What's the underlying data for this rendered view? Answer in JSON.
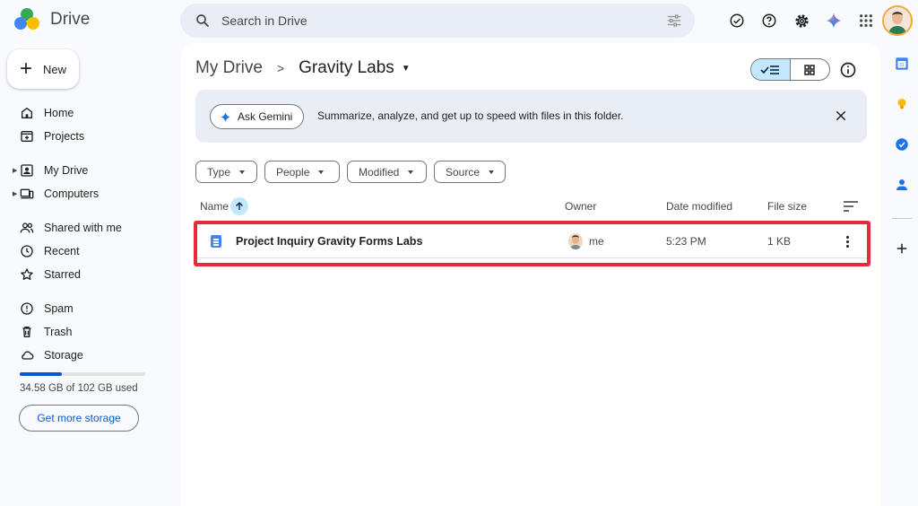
{
  "app": {
    "name": "Drive"
  },
  "search": {
    "placeholder": "Search in Drive"
  },
  "header_icons": [
    "offline-ready-icon",
    "help-icon",
    "settings-icon",
    "gemini-icon",
    "apps-grid-icon"
  ],
  "new_button": {
    "label": "New"
  },
  "sidebar": {
    "items": [
      {
        "label": "Home",
        "icon": "home-icon"
      },
      {
        "label": "Projects",
        "icon": "projects-icon"
      },
      {
        "label": "My Drive",
        "icon": "my-drive-icon"
      },
      {
        "label": "Computers",
        "icon": "computers-icon"
      },
      {
        "label": "Shared with me",
        "icon": "shared-icon"
      },
      {
        "label": "Recent",
        "icon": "clock-icon"
      },
      {
        "label": "Starred",
        "icon": "star-icon"
      },
      {
        "label": "Spam",
        "icon": "spam-icon"
      },
      {
        "label": "Trash",
        "icon": "trash-icon"
      },
      {
        "label": "Storage",
        "icon": "cloud-icon"
      }
    ],
    "storage": {
      "text": "34.58 GB of 102 GB used",
      "used_fraction": 0.339,
      "button_label": "Get more storage"
    }
  },
  "breadcrumb": {
    "root": "My Drive",
    "separator": ">",
    "current": "Gravity Labs"
  },
  "gemini_banner": {
    "button_label": "Ask Gemini",
    "text": "Summarize, analyze, and get up to speed with files in this folder."
  },
  "filters": [
    {
      "label": "Type"
    },
    {
      "label": "People"
    },
    {
      "label": "Modified"
    },
    {
      "label": "Source"
    }
  ],
  "table": {
    "columns": {
      "name": "Name",
      "owner": "Owner",
      "date": "Date modified",
      "size": "File size"
    },
    "rows": [
      {
        "name": "Project Inquiry Gravity Forms Labs",
        "owner": "me",
        "date": "5:23 PM",
        "size": "1 KB",
        "type": "document-icon"
      }
    ]
  },
  "colors": {
    "accent": "#0b57d0",
    "highlight": "#e52b3c",
    "selected": "#c2e7ff",
    "banner": "#e9eef6"
  }
}
